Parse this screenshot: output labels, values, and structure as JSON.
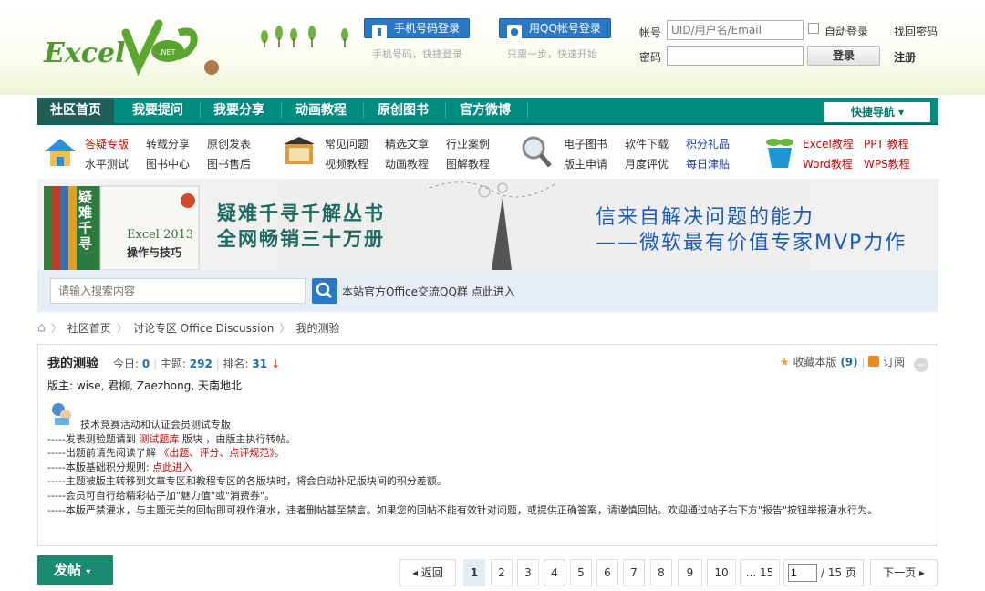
{
  "header": {
    "brand_text": "ExcelVip.NET",
    "phone_login": "手机号码登录",
    "phone_login_sub": "手机号码，快捷登录",
    "qq_login": "用QQ帐号登录",
    "qq_login_sub": "只需一步，快速开始",
    "account_label": "帐号",
    "account_placeholder": "UID/用户名/Email",
    "password_label": "密码",
    "auto_login": "自动登录",
    "find_password": "找回密码",
    "login": "登录",
    "register": "注册"
  },
  "nav": {
    "items": [
      "社区首页",
      "我要提问",
      "我要分享",
      "动画教程",
      "原创图书",
      "官方微博"
    ],
    "quick": "快捷导航"
  },
  "menu": {
    "g1": [
      "答疑专版",
      "转载分享",
      "原创发表",
      "水平测试",
      "图书中心",
      "图书售后"
    ],
    "g2": [
      "常见问题",
      "精选文章",
      "行业案例",
      "视频教程",
      "动画教程",
      "图解教程"
    ],
    "g3": [
      "电子图书",
      "软件下载",
      "积分礼品",
      "版主申请",
      "月度评优",
      "每日津贴"
    ],
    "g4": [
      "Excel教程",
      "PPT 教程",
      "Word教程",
      "WPS教程"
    ]
  },
  "banner": {
    "book_cover": "Excel 2013",
    "book_sub": "操作与技巧",
    "book_title": "疑难千寻",
    "line1": "疑难千寻千解丛书",
    "line2": "全网畅销三十万册",
    "line3": "信来自解决问题的能力",
    "line4": "——微软最有价值专家MVP力作"
  },
  "search": {
    "placeholder": "请输入搜索内容",
    "qq_group": "本站官方Office交流QQ群 点此进入"
  },
  "breadcrumb": [
    "社区首页",
    "讨论专区 Office Discussion",
    "我的测验"
  ],
  "forum": {
    "title": "我的测验",
    "today_label": "今日:",
    "today": "0",
    "topics_label": "主题:",
    "topics": "292",
    "rank_label": "排名:",
    "rank": "31",
    "favorite": "收藏本版",
    "favorite_count": "(9)",
    "subscribe": "订阅",
    "moderators": "版主: wise, 君柳, Zaezhong, 天南地北",
    "intro": "技术竞赛活动和认证会员测试专版",
    "r1a": "-----发表测验题请到 ",
    "r1b": "测试题库",
    "r1c": " 版块 ，由版主执行转帖。",
    "r2a": "-----出题前请先阅读了解 ",
    "r2b": "《出题、评分、点评规范》",
    "r2c": "。",
    "r3a": "-----本版基础积分规则: ",
    "r3b": "点此进入",
    "r4": "-----主题被版主转移到文章专区和教程专区的各版块时，将会自动补足版块间的积分差额。",
    "r5": "-----会员可自行给精彩帖子加\"魅力值\"或\"消费券\"。",
    "r6": "-----本版严禁灌水，与主题无关的回帖即可视作灌水，违者删帖甚至禁言。如果您的回帖不能有效针对问题，或提供正确答案，请谨慎回帖。欢迎通过帖子右下方\"报告\"按钮举报灌水行为。"
  },
  "pager": {
    "post": "发帖",
    "back": "◂ 返回",
    "pages": [
      "1",
      "2",
      "3",
      "4",
      "5",
      "6",
      "7",
      "8",
      "9",
      "10"
    ],
    "last": "... 15",
    "input": "1",
    "total": "/ 15 页",
    "next": "下一页 ▸"
  },
  "colors": {
    "nav_bg": "#008c7e",
    "link_red": "#d10000",
    "accent_blue": "#2a79c7",
    "post_btn": "#19896f"
  }
}
